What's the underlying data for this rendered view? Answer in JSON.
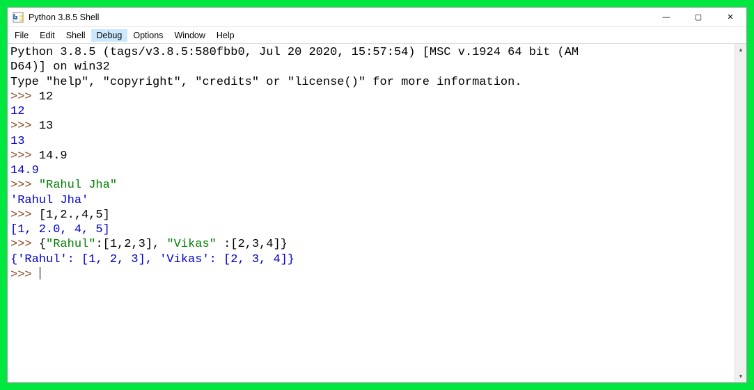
{
  "window": {
    "title": "Python 3.8.5 Shell",
    "minimize_label": "—",
    "maximize_label": "▢",
    "close_label": "✕"
  },
  "menu": {
    "items": [
      "File",
      "Edit",
      "Shell",
      "Debug",
      "Options",
      "Window",
      "Help"
    ],
    "active_index": 3
  },
  "banner": {
    "line1": "Python 3.8.5 (tags/v3.8.5:580fbb0, Jul 20 2020, 15:57:54) [MSC v.1924 64 bit (AM",
    "line2": "D64)] on win32",
    "line3": "Type \"help\", \"copyright\", \"credits\" or \"license()\" for more information."
  },
  "repl": {
    "prompt": ">>>",
    "entries": [
      {
        "input_plain": "12",
        "input_string": "",
        "output": "12"
      },
      {
        "input_plain": "13",
        "input_string": "",
        "output": "13"
      },
      {
        "input_plain": "14.9",
        "input_string": "",
        "output": "14.9"
      },
      {
        "input_plain": "",
        "input_string": "\"Rahul Jha\"",
        "output": "'Rahul Jha'"
      },
      {
        "input_plain": "[1,2.,4,5]",
        "input_string": "",
        "output": "[1, 2.0, 4, 5]"
      },
      {
        "input_dict": {
          "pre": "{",
          "k1": "\"Rahul\"",
          "m1": ":[1,2,3], ",
          "k2": "\"Vikas\"",
          "m2": " :[2,3,4]}"
        },
        "output": "{'Rahul': [1, 2, 3], 'Vikas': [2, 3, 4]}"
      }
    ]
  },
  "colors": {
    "border": "#00e840",
    "prompt": "#8b4726",
    "number": "#0000cc",
    "string": "#008000"
  }
}
